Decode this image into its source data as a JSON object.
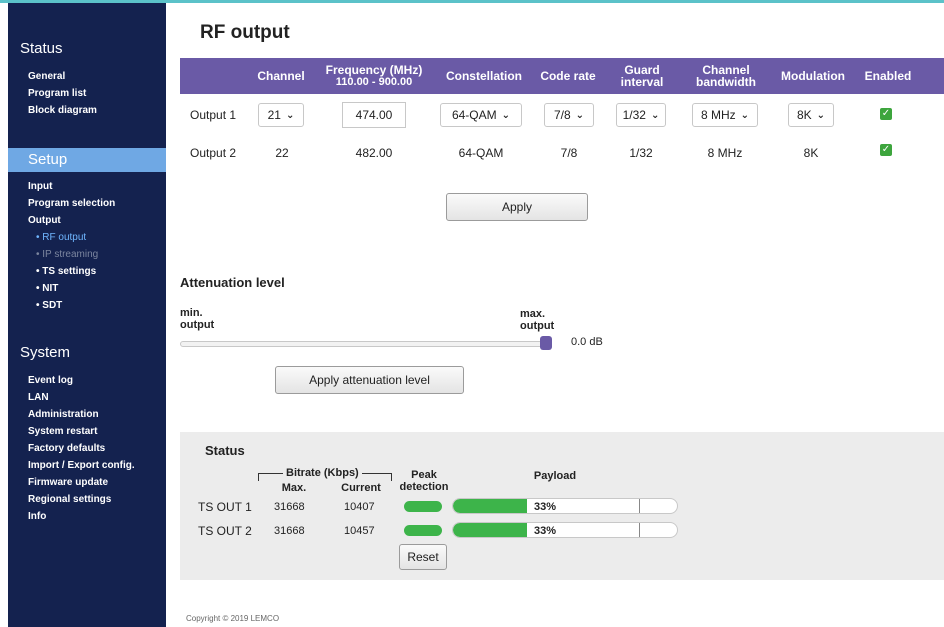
{
  "sidebar": {
    "status": {
      "title": "Status",
      "items": [
        "General",
        "Program list",
        "Block diagram"
      ]
    },
    "setup": {
      "title": "Setup",
      "items": [
        "Input",
        "Program selection",
        "Output"
      ],
      "sub_items": [
        "• RF output",
        "• IP streaming",
        "• TS settings",
        "• NIT",
        "• SDT"
      ]
    },
    "system": {
      "title": "System",
      "items": [
        "Event log",
        "LAN",
        "Administration",
        "System restart",
        "Factory defaults",
        "Import / Export config.",
        "Firmware update",
        "Regional settings",
        "Info"
      ]
    }
  },
  "page": {
    "title": "RF output"
  },
  "rf_table": {
    "headers": {
      "channel": "Channel",
      "frequency": "Frequency (MHz)",
      "frequency_range": "110.00 - 900.00",
      "constellation": "Constellation",
      "code_rate": "Code rate",
      "guard_1": "Guard",
      "guard_2": "interval",
      "bw_1": "Channel",
      "bw_2": "bandwidth",
      "modulation": "Modulation",
      "enabled": "Enabled"
    },
    "rows": [
      {
        "label": "Output 1",
        "channel": "21",
        "frequency": "474.00",
        "constellation": "64-QAM",
        "code_rate": "7/8",
        "guard": "1/32",
        "bandwidth": "8 MHz",
        "modulation": "8K",
        "enabled": "✓"
      },
      {
        "label": "Output 2",
        "channel": "22",
        "frequency": "482.00",
        "constellation": "64-QAM",
        "code_rate": "7/8",
        "guard": "1/32",
        "bandwidth": "8 MHz",
        "modulation": "8K",
        "enabled": "✓"
      }
    ],
    "apply_label": "Apply"
  },
  "attenuation": {
    "title": "Attenuation level",
    "min_1": "min.",
    "min_2": "output",
    "max_1": "max.",
    "max_2": "output",
    "value": "0.0 dB",
    "level_fraction": 1.0,
    "apply_label": "Apply attenuation level"
  },
  "status": {
    "title": "Status",
    "bitrate_label": "Bitrate (Kbps)",
    "max_label": "Max.",
    "current_label": "Current",
    "peak_1": "Peak",
    "peak_2": "detection",
    "payload_label": "Payload",
    "rows": [
      {
        "label": "TS OUT 1",
        "max": "31668",
        "current": "10407",
        "payload": "33%",
        "payload_fraction": 0.33
      },
      {
        "label": "TS OUT 2",
        "max": "31668",
        "current": "10457",
        "payload": "33%",
        "payload_fraction": 0.33
      }
    ],
    "reset_label": "Reset"
  },
  "footer": {
    "copyright": "Copyright © 2019 LEMCO"
  },
  "colors": {
    "sidebar_bg": "#14224f",
    "setup_highlight": "#6fa8e4",
    "table_header": "#6a5aa6",
    "progress_green": "#3db44a",
    "enabled_green": "#3da53d"
  }
}
